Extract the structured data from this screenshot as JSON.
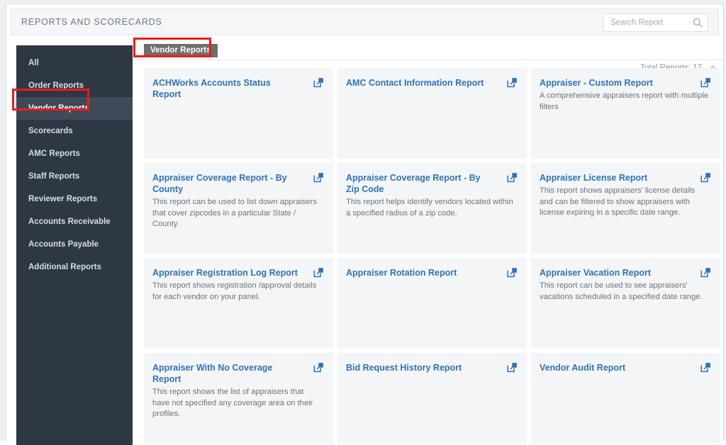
{
  "header": {
    "title": "REPORTS AND SCORECARDS",
    "search_placeholder": "Search Report",
    "search_value": "",
    "search_icon": "search-icon"
  },
  "sidebar": {
    "items": [
      {
        "label": "All",
        "active": false
      },
      {
        "label": "Order Reports",
        "active": false
      },
      {
        "label": "Vendor Reports",
        "active": true
      },
      {
        "label": "Scorecards",
        "active": false
      },
      {
        "label": "AMC Reports",
        "active": false
      },
      {
        "label": "Staff Reports",
        "active": false
      },
      {
        "label": "Reviewer Reports",
        "active": false
      },
      {
        "label": "Accounts Receivable",
        "active": false
      },
      {
        "label": "Accounts Payable",
        "active": false
      },
      {
        "label": "Additional Reports",
        "active": false
      }
    ]
  },
  "content": {
    "tab_label": "Vendor Reports",
    "total_reports_label": "Total Reports: 17",
    "collapse_icon": "double-chevron-up-icon",
    "cards": [
      {
        "title": "ACHWorks Accounts Status Report",
        "description": "",
        "icon": "external-link-icon"
      },
      {
        "title": "AMC Contact Information Report",
        "description": "",
        "icon": "external-link-icon"
      },
      {
        "title": "Appraiser - Custom Report",
        "description": "A comprehensive appraisers report with multiple filters",
        "icon": "external-link-icon"
      },
      {
        "title": "Appraiser Coverage Report - By County",
        "description": "This report can be used to list down appraisers that cover zipcodes in a particular State / County",
        "icon": "external-link-icon"
      },
      {
        "title": "Appraiser Coverage Report - By Zip Code",
        "description": "This report helps identify vendors located within a specified radius of a zip code.",
        "icon": "external-link-icon"
      },
      {
        "title": "Appraiser License Report",
        "description": "This report shows appraisers' license details and can be filtered to show appraisers with license expiring in a specific date range.",
        "icon": "external-link-icon"
      },
      {
        "title": "Appraiser Registration Log Report",
        "description": "This report shows registration /approval details for each vendor on your panel.",
        "icon": "external-link-icon"
      },
      {
        "title": "Appraiser Rotation Report",
        "description": "",
        "icon": "external-link-icon"
      },
      {
        "title": "Appraiser Vacation Report",
        "description": "This report can be used to see appraisers' vacations scheduled in a specified date range.",
        "icon": "external-link-icon"
      },
      {
        "title": "Appraiser With No Coverage Report",
        "description": "This report shows the list of appraisers that have not specified any coverage area on their profiles.",
        "icon": "external-link-icon"
      },
      {
        "title": "Bid Request History Report",
        "description": "",
        "icon": "external-link-icon"
      },
      {
        "title": "Vendor Audit Report",
        "description": "",
        "icon": "external-link-icon"
      }
    ]
  },
  "colors": {
    "sidebar_bg": "#2e3744",
    "sidebar_active_bg": "#3f4957",
    "card_bg": "#f4f5f6",
    "link_blue": "#2f72b5",
    "tab_bg": "#6e6e6e",
    "annotation_red": "#ee1b17"
  }
}
